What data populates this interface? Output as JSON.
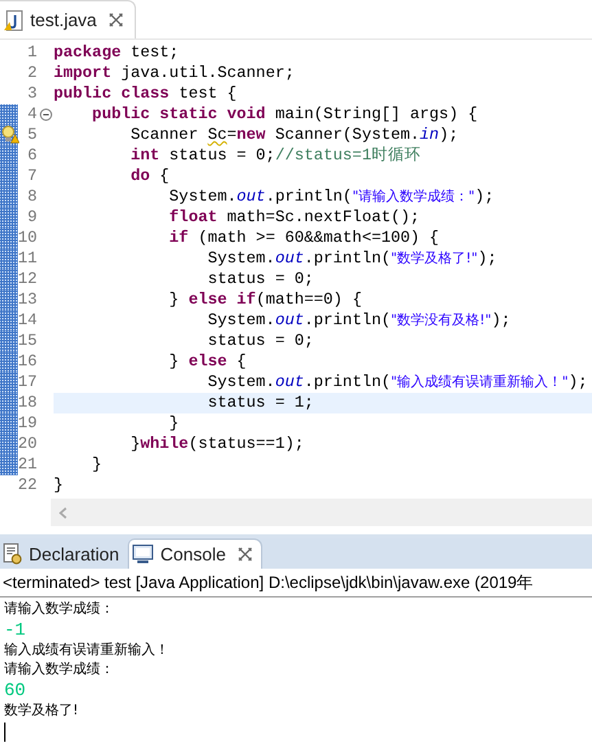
{
  "editor": {
    "tabs": [
      {
        "label": "test.java",
        "selected": true
      }
    ],
    "lines": [
      {
        "number": "1",
        "segments": [
          {
            "kind": "kw",
            "text": "package "
          },
          {
            "kind": "plain",
            "text": "test;"
          }
        ]
      },
      {
        "number": "2",
        "segments": [
          {
            "kind": "kw",
            "text": "import "
          },
          {
            "kind": "plain",
            "text": "java.util.Scanner;"
          }
        ]
      },
      {
        "number": "3",
        "segments": [
          {
            "kind": "kw",
            "text": "public class "
          },
          {
            "kind": "plain",
            "text": "test {"
          }
        ]
      },
      {
        "number": "4",
        "changed": true,
        "expanded": true,
        "segments": [
          {
            "kind": "kw",
            "text": "    public static void "
          },
          {
            "kind": "plain",
            "text": "main(String[] args) {"
          }
        ]
      },
      {
        "number": "5",
        "changed": true,
        "warning": true,
        "segments": [
          {
            "kind": "plain",
            "text": "        Scanner "
          },
          {
            "kind": "squiggle",
            "text": "Sc"
          },
          {
            "kind": "plain",
            "text": "="
          },
          {
            "kind": "kw",
            "text": "new "
          },
          {
            "kind": "plain",
            "text": "Scanner(System."
          },
          {
            "kind": "field",
            "text": "in"
          },
          {
            "kind": "plain",
            "text": ");"
          }
        ]
      },
      {
        "number": "6",
        "changed": true,
        "segments": [
          {
            "kind": "kw",
            "text": "        int "
          },
          {
            "kind": "plain",
            "text": "status = 0;"
          },
          {
            "kind": "comment",
            "text": "//status=1时循环"
          }
        ]
      },
      {
        "number": "7",
        "changed": true,
        "segments": [
          {
            "kind": "kw",
            "text": "        do "
          },
          {
            "kind": "plain",
            "text": "{"
          }
        ]
      },
      {
        "number": "8",
        "changed": true,
        "segments": [
          {
            "kind": "plain",
            "text": "            System."
          },
          {
            "kind": "field",
            "text": "out"
          },
          {
            "kind": "plain",
            "text": ".println("
          },
          {
            "kind": "str",
            "text": "\"请输入数学成绩：\""
          },
          {
            "kind": "plain",
            "text": ");"
          }
        ]
      },
      {
        "number": "9",
        "changed": true,
        "segments": [
          {
            "kind": "kw",
            "text": "            float "
          },
          {
            "kind": "plain",
            "text": "math=Sc.nextFloat();"
          }
        ]
      },
      {
        "number": "10",
        "changed": true,
        "segments": [
          {
            "kind": "kw",
            "text": "            if "
          },
          {
            "kind": "plain",
            "text": "(math >= 60&&math<=100) {"
          }
        ]
      },
      {
        "number": "11",
        "changed": true,
        "segments": [
          {
            "kind": "plain",
            "text": "                System."
          },
          {
            "kind": "field",
            "text": "out"
          },
          {
            "kind": "plain",
            "text": ".println("
          },
          {
            "kind": "str",
            "text": "\"数学及格了!\""
          },
          {
            "kind": "plain",
            "text": ");"
          }
        ]
      },
      {
        "number": "12",
        "changed": true,
        "segments": [
          {
            "kind": "plain",
            "text": "                status = 0;"
          }
        ]
      },
      {
        "number": "13",
        "changed": true,
        "segments": [
          {
            "kind": "plain",
            "text": "            } "
          },
          {
            "kind": "kw",
            "text": "else if"
          },
          {
            "kind": "plain",
            "text": "(math==0) {"
          }
        ]
      },
      {
        "number": "14",
        "changed": true,
        "segments": [
          {
            "kind": "plain",
            "text": "                System."
          },
          {
            "kind": "field",
            "text": "out"
          },
          {
            "kind": "plain",
            "text": ".println("
          },
          {
            "kind": "str",
            "text": "\"数学没有及格!\""
          },
          {
            "kind": "plain",
            "text": ");"
          }
        ]
      },
      {
        "number": "15",
        "changed": true,
        "segments": [
          {
            "kind": "plain",
            "text": "                status = 0;"
          }
        ]
      },
      {
        "number": "16",
        "changed": true,
        "segments": [
          {
            "kind": "plain",
            "text": "            } "
          },
          {
            "kind": "kw",
            "text": "else "
          },
          {
            "kind": "plain",
            "text": "{"
          }
        ]
      },
      {
        "number": "17",
        "changed": true,
        "segments": [
          {
            "kind": "plain",
            "text": "                System."
          },
          {
            "kind": "field",
            "text": "out"
          },
          {
            "kind": "plain",
            "text": ".println("
          },
          {
            "kind": "str",
            "text": "\"输入成绩有误请重新输入！\""
          },
          {
            "kind": "plain",
            "text": ");"
          }
        ]
      },
      {
        "number": "18",
        "current": true,
        "changed": true,
        "segments": [
          {
            "kind": "plain",
            "text": "                status = 1;"
          }
        ]
      },
      {
        "number": "19",
        "changed": true,
        "segments": [
          {
            "kind": "plain",
            "text": "            }"
          }
        ]
      },
      {
        "number": "20",
        "changed": true,
        "segments": [
          {
            "kind": "plain",
            "text": "        }"
          },
          {
            "kind": "kw",
            "text": "while"
          },
          {
            "kind": "plain",
            "text": "(status==1);"
          }
        ]
      },
      {
        "number": "21",
        "changed": true,
        "segments": [
          {
            "kind": "plain",
            "text": "    }"
          }
        ]
      },
      {
        "number": "22",
        "segments": [
          {
            "kind": "plain",
            "text": "}"
          }
        ]
      }
    ]
  },
  "bottom_panel": {
    "tabs": [
      {
        "label": "Declaration",
        "kind": "declaration",
        "selected": false
      },
      {
        "label": "Console",
        "kind": "console",
        "selected": true
      }
    ],
    "console_header": "<terminated> test [Java Application] D:\\eclipse\\jdk\\bin\\javaw.exe (2019年",
    "output": [
      {
        "kind": "output",
        "text": "请输入数学成绩："
      },
      {
        "kind": "input",
        "text": "-1"
      },
      {
        "kind": "output",
        "text": "输入成绩有误请重新输入！"
      },
      {
        "kind": "output",
        "text": "请输入数学成绩："
      },
      {
        "kind": "input",
        "text": "60"
      },
      {
        "kind": "output",
        "text": "数学及格了!"
      }
    ]
  }
}
